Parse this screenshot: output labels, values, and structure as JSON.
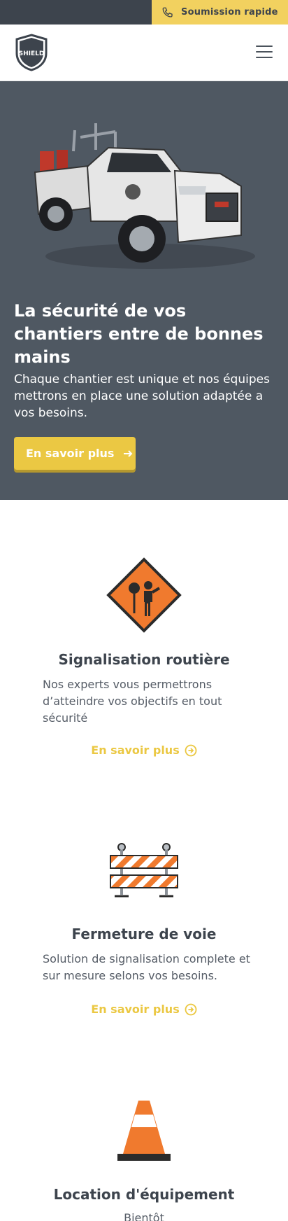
{
  "topbar": {
    "quick_quote_label": "Soumission rapide",
    "quick_quote_icon": "phone-icon"
  },
  "navbar": {
    "logo_text": "SHIELD",
    "menu_icon": "hamburger-menu-icon"
  },
  "hero": {
    "title": "La sécurité de vos chantiers entre de bonnes mains",
    "subtitle": "Chaque chantier est unique et nos équipes mettrons en place une solution adaptée a vos besoins.",
    "cta_label": "En savoir plus",
    "cta_icon": "arrow-right-icon"
  },
  "services": [
    {
      "title": "Signalisation routière",
      "description": "Nos experts vous permettrons d’atteindre vos objectifs en tout sécurité",
      "link_label": "En savoir plus",
      "icon": "flagger-sign-icon"
    },
    {
      "title": "Fermeture de voie",
      "description": "Solution de signalisation complete et sur mesure selons vos besoins.",
      "link_label": "En savoir plus",
      "icon": "road-barrier-icon"
    },
    {
      "title": "Location d'équipement",
      "description": "Bientôt",
      "icon": "traffic-cone-icon"
    }
  ],
  "colors": {
    "accent": "#ebc843",
    "dark": "#3d444d",
    "hero_bg": "#4f5862",
    "orange": "#f07a2e"
  }
}
